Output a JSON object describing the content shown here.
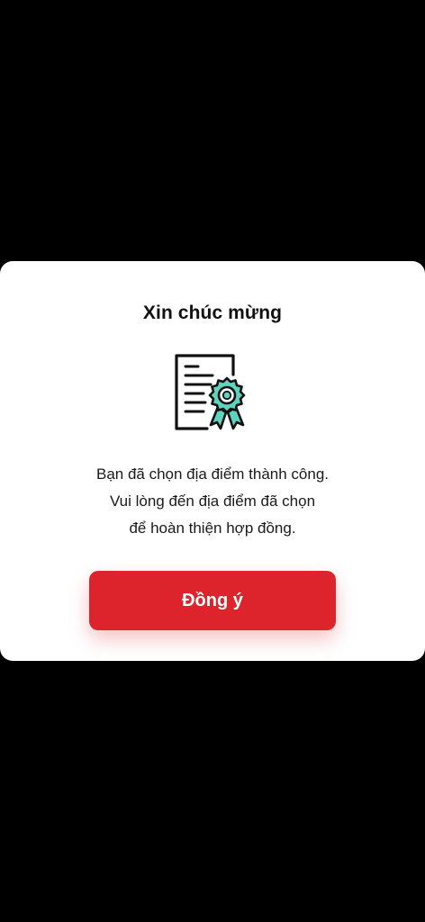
{
  "dialog": {
    "title": "Xin chúc mừng",
    "icon": "certificate-icon",
    "message_lines": [
      "Bạn đã chọn địa điểm thành công.",
      "Vui lòng đến địa điểm đã chọn",
      "để hoàn thiện hợp đồng."
    ],
    "confirm_label": "Đồng ý"
  },
  "colors": {
    "accent": "#dd242c",
    "icon_badge": "#5fd3bd",
    "backdrop": "#000000",
    "surface": "#ffffff"
  }
}
